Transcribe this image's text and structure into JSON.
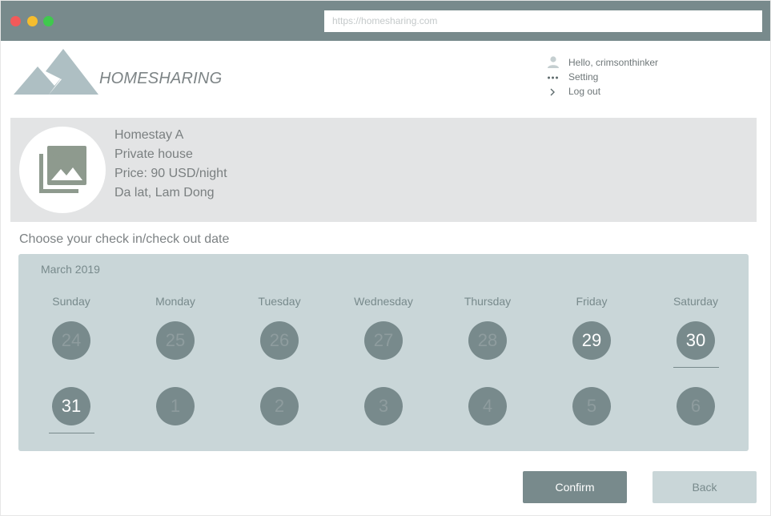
{
  "browser": {
    "url": "https://homesharing.com"
  },
  "header": {
    "brand": "HOMESHARING",
    "menu": [
      {
        "label": "Hello, crimsonthinker",
        "icon": "user-icon"
      },
      {
        "label": "Setting",
        "icon": "more-dots-icon"
      },
      {
        "label": "Log out",
        "icon": "chevron-right-icon"
      }
    ]
  },
  "listing": {
    "name": "Homestay A",
    "type": "Private house",
    "price": "Price: 90 USD/night",
    "location": "Da lat, Lam Dong",
    "image_icon": "image-gallery-icon"
  },
  "calendar": {
    "prompt": "Choose your check in/check out date",
    "month": "March 2019",
    "weekdays": [
      "Sunday",
      "Monday",
      "Tuesday",
      "Wednesday",
      "Thursday",
      "Friday",
      "Saturday"
    ],
    "weeks": [
      [
        {
          "day": "24",
          "available": false,
          "selected": false
        },
        {
          "day": "25",
          "available": false,
          "selected": false
        },
        {
          "day": "26",
          "available": false,
          "selected": false
        },
        {
          "day": "27",
          "available": false,
          "selected": false
        },
        {
          "day": "28",
          "available": false,
          "selected": false
        },
        {
          "day": "29",
          "available": true,
          "selected": false
        },
        {
          "day": "30",
          "available": true,
          "selected": true
        }
      ],
      [
        {
          "day": "31",
          "available": true,
          "selected": true
        },
        {
          "day": "1",
          "available": false,
          "selected": false
        },
        {
          "day": "2",
          "available": false,
          "selected": false
        },
        {
          "day": "3",
          "available": false,
          "selected": false
        },
        {
          "day": "4",
          "available": false,
          "selected": false
        },
        {
          "day": "5",
          "available": false,
          "selected": false
        },
        {
          "day": "6",
          "available": false,
          "selected": false
        }
      ]
    ]
  },
  "actions": {
    "confirm_label": "Confirm",
    "back_label": "Back"
  },
  "colors": {
    "chrome": "#788a8c",
    "calendar_bg": "#c9d6d8",
    "listing_bg": "#e3e4e5",
    "accent": "#788a8c"
  }
}
